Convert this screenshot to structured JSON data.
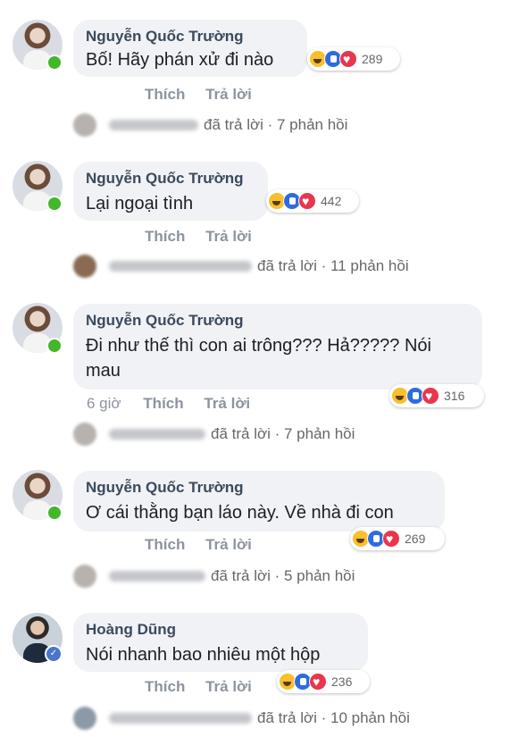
{
  "comments": [
    {
      "author": "Nguyễn Quốc Trường",
      "text": "Bố! Hãy phán xử đi nào",
      "reaction_count": "289",
      "like": "Thích",
      "reply": "Trả lời",
      "time": "",
      "replies_text": "đã trả lời · 7 phản hồi",
      "avatar_badge": "online"
    },
    {
      "author": "Nguyễn Quốc Trường",
      "text": "Lại ngoại tình",
      "reaction_count": "442",
      "like": "Thích",
      "reply": "Trả lời",
      "time": "",
      "replies_text": "đã trả lời · 11 phản hồi",
      "avatar_badge": "online"
    },
    {
      "author": "Nguyễn Quốc Trường",
      "text": "Đi như thế thì con ai trông??? Hả????? Nói mau",
      "reaction_count": "316",
      "like": "Thích",
      "reply": "Trả lời",
      "time": "6 giờ",
      "replies_text": "đã trả lời · 7 phản hồi",
      "avatar_badge": "online"
    },
    {
      "author": "Nguyễn Quốc Trường",
      "text": "Ơ cái thằng bạn láo này. Về nhà đi con",
      "reaction_count": "269",
      "like": "Thích",
      "reply": "Trả lời",
      "time": "",
      "replies_text": "đã trả lời · 5 phản hồi",
      "avatar_badge": "online"
    },
    {
      "author": "Hoàng Dũng",
      "text": "Nói nhanh bao nhiêu một hộp",
      "reaction_count": "236",
      "like": "Thích",
      "reply": "Trả lời",
      "time": "",
      "replies_text": "đã trả lời · 10 phản hồi",
      "avatar_badge": "verified"
    }
  ],
  "reaction_icons": [
    "haha-icon",
    "like-icon",
    "love-icon"
  ],
  "colors": {
    "bubble": "#f0f2f5",
    "author": "#3b4a5d",
    "online": "#42b72a",
    "like": "#2d6be0",
    "love": "#e8364c",
    "haha": "#f7c02c"
  }
}
